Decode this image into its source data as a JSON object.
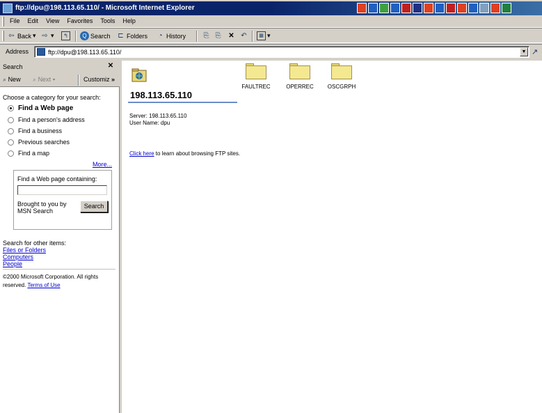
{
  "window": {
    "title": "ftp://dpu@198.113.65.110/ - Microsoft Internet Explorer",
    "taskbar_icon_colors": [
      "#e04020",
      "#2060c0",
      "#40a040",
      "#2060c0",
      "#c02020",
      "#203080",
      "#e04020",
      "#2060c0",
      "#c02020",
      "#e04020",
      "#2060c0",
      "#80a0c0",
      "#e04020",
      "#208040"
    ]
  },
  "menubar": {
    "items": [
      "File",
      "Edit",
      "View",
      "Favorites",
      "Tools",
      "Help"
    ]
  },
  "toolbar": {
    "back": "Back",
    "forward": "",
    "up": "",
    "search": "Search",
    "folders": "Folders",
    "history": "History"
  },
  "address": {
    "label": "Address",
    "value": "ftp://dpu@198.113.65.110/"
  },
  "search_pane": {
    "title": "Search",
    "new": "New",
    "next": "Next",
    "customize": "Customiz",
    "choose": "Choose a category for your search:",
    "options": [
      {
        "label": "Find a Web page",
        "checked": true
      },
      {
        "label": "Find a person's address",
        "checked": false
      },
      {
        "label": "Find a business",
        "checked": false
      },
      {
        "label": "Previous searches",
        "checked": false
      },
      {
        "label": "Find a map",
        "checked": false
      }
    ],
    "more": "More...",
    "find_label": "Find a Web page containing:",
    "find_value": "",
    "brought": "Brought to you by MSN Search",
    "search_button": "Search",
    "other_label": "Search for other items:",
    "other_links": [
      "Files or Folders",
      "Computers",
      "People"
    ],
    "copyright": "©2000 Microsoft Corporation. All rights reserved.",
    "terms": "Terms of Use"
  },
  "main": {
    "host": "198.113.65.110",
    "server_line": "Server: 198.113.65.110",
    "user_line": "User Name: dpu",
    "click_link": "Click here",
    "click_rest": " to learn about browsing FTP sites.",
    "folders": [
      "FAULTREC",
      "OPERREC",
      "OSCGRPH"
    ]
  }
}
